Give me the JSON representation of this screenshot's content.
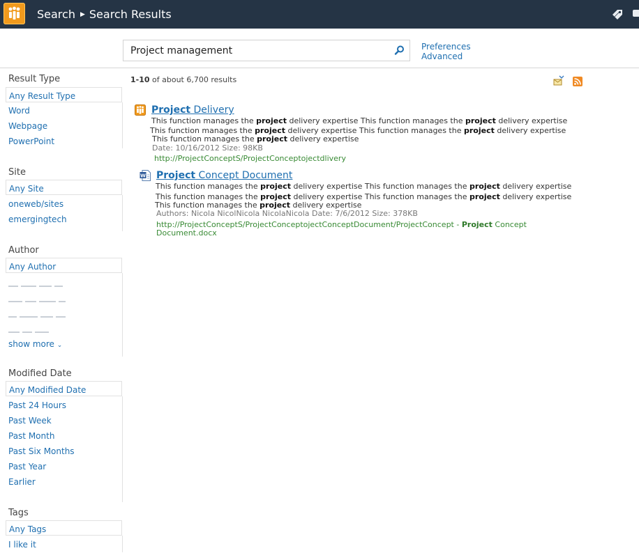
{
  "topbar": {
    "breadcrumb_1": "Search",
    "breadcrumb_2": "Search Results",
    "logo_icon": "sharepoint-logo-icon",
    "tag_icon": "tags-notes-icon"
  },
  "search": {
    "query": "Project management",
    "search_icon": "magnifier-icon",
    "preferences_link": "Preferences",
    "advanced_link": "Advanced"
  },
  "refiners": {
    "result_type": {
      "title": "Result Type",
      "any": "Any Result Type",
      "items": [
        "Word",
        "Webpage",
        "PowerPoint"
      ]
    },
    "site": {
      "title": "Site",
      "any": "Any Site",
      "items": [
        "oneweb/sites",
        "emergingtech"
      ]
    },
    "author": {
      "title": "Author",
      "any": "Any Author",
      "show_more": "show more"
    },
    "modified_date": {
      "title": "Modified Date",
      "any": "Any Modified Date",
      "items": [
        "Past 24 Hours",
        "Past Week",
        "Past Month",
        "Past Six Months",
        "Past Year",
        "Earlier"
      ]
    },
    "tags": {
      "title": "Tags",
      "any": "Any Tags",
      "items": [
        "I like it"
      ]
    }
  },
  "results_summary": {
    "range": "1-10",
    "rest": "of about 6,700 results"
  },
  "results": [
    {
      "icon": "sharepoint-page-icon",
      "title_bold": "Project",
      "title_rest": " Delivery",
      "snippet_1a": "This function manages the ",
      "snippet_1b": "project",
      "snippet_1c": " delivery expertise This function manages the ",
      "snippet_1d": "project",
      "snippet_1e": " delivery expertise",
      "snippet_2a": "This function manages the ",
      "snippet_2b": "project",
      "snippet_2c": " delivery expertise This function manages the ",
      "snippet_2d": "project",
      "snippet_2e": " delivery expertise",
      "snippet_3a": "This function manages the ",
      "snippet_3b": "project",
      "snippet_3c": " delivery expertise",
      "meta": "Date: 10/16/2012   Size: 98KB",
      "url": "http://ProjectConceptS/ProjectConceptojectdlivery"
    },
    {
      "icon": "word-document-icon",
      "title_bold": "Project",
      "title_rest": " Concept Document",
      "snippet_1a": "This function manages the ",
      "snippet_1b": "project",
      "snippet_1c": " delivery expertise This function manages the ",
      "snippet_1d": "project",
      "snippet_1e": " delivery expertise",
      "snippet_2a": "This function manages the ",
      "snippet_2b": "project",
      "snippet_2c": " delivery expertise This function manages the ",
      "snippet_2d": "project",
      "snippet_2e": " delivery expertise",
      "snippet_3a": "This function manages the ",
      "snippet_3b": "project",
      "snippet_3c": " delivery expertise",
      "meta": "Authors: Nicola NicolNicola NicolaNicola Date: 7/6/2012   Size: 378KB",
      "url_a": "http://ProjectConceptS/ProjectConceptojectConceptDocument/ProjectConcept - ",
      "url_b": "Project",
      "url_c": " Concept",
      "url_d": "Document.docx"
    }
  ],
  "colors": {
    "topbar": "#253445",
    "link": "#1f6fb0",
    "url": "#388a34",
    "logo": "#f19a1d",
    "rss": "#f08a24"
  }
}
